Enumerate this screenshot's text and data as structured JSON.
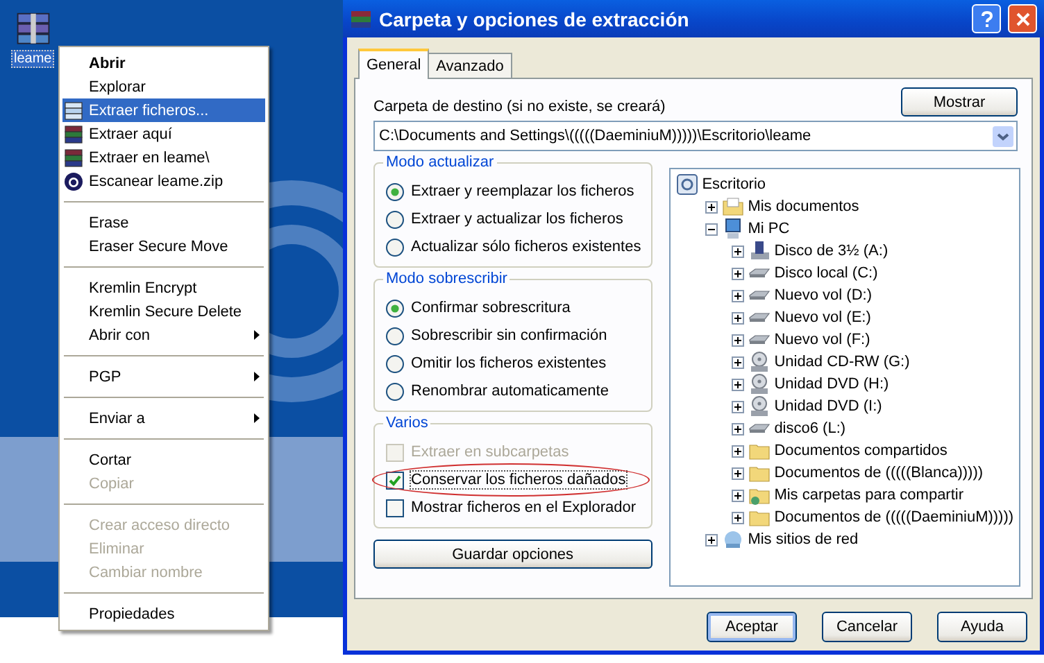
{
  "desktop": {
    "icon": {
      "label": "leame",
      "selected": true
    }
  },
  "context_menu": {
    "items": [
      {
        "kind": "text",
        "label": "Abrir",
        "bold": true,
        "selected": false,
        "disabled": false,
        "submenu": false
      },
      {
        "kind": "text",
        "label": "Explorar",
        "bold": false,
        "selected": false,
        "disabled": false,
        "submenu": false
      },
      {
        "kind": "archive-open",
        "label": "Extraer ficheros...",
        "bold": false,
        "selected": true,
        "disabled": false,
        "submenu": false
      },
      {
        "kind": "archive",
        "label": "Extraer aquí",
        "bold": false,
        "selected": false,
        "disabled": false,
        "submenu": false
      },
      {
        "kind": "archive",
        "label": "Extraer en leame\\",
        "bold": false,
        "selected": false,
        "disabled": false,
        "submenu": false
      },
      {
        "kind": "scan",
        "label": "Escanear leame.zip",
        "bold": false,
        "selected": false,
        "disabled": false,
        "submenu": false
      },
      {
        "kind": "separator"
      },
      {
        "kind": "text",
        "label": "Erase",
        "bold": false,
        "selected": false,
        "disabled": false,
        "submenu": false
      },
      {
        "kind": "text",
        "label": "Eraser Secure Move",
        "bold": false,
        "selected": false,
        "disabled": false,
        "submenu": false
      },
      {
        "kind": "separator"
      },
      {
        "kind": "text",
        "label": "Kremlin Encrypt",
        "bold": false,
        "selected": false,
        "disabled": false,
        "submenu": false
      },
      {
        "kind": "text",
        "label": "Kremlin Secure Delete",
        "bold": false,
        "selected": false,
        "disabled": false,
        "submenu": false
      },
      {
        "kind": "text",
        "label": "Abrir con",
        "bold": false,
        "selected": false,
        "disabled": false,
        "submenu": true
      },
      {
        "kind": "separator"
      },
      {
        "kind": "text",
        "label": "PGP",
        "bold": false,
        "selected": false,
        "disabled": false,
        "submenu": true
      },
      {
        "kind": "separator"
      },
      {
        "kind": "text",
        "label": "Enviar a",
        "bold": false,
        "selected": false,
        "disabled": false,
        "submenu": true
      },
      {
        "kind": "separator"
      },
      {
        "kind": "text",
        "label": "Cortar",
        "bold": false,
        "selected": false,
        "disabled": false,
        "submenu": false
      },
      {
        "kind": "text",
        "label": "Copiar",
        "bold": false,
        "selected": false,
        "disabled": true,
        "submenu": false
      },
      {
        "kind": "separator"
      },
      {
        "kind": "text",
        "label": "Crear acceso directo",
        "bold": false,
        "selected": false,
        "disabled": true,
        "submenu": false
      },
      {
        "kind": "text",
        "label": "Eliminar",
        "bold": false,
        "selected": false,
        "disabled": true,
        "submenu": false
      },
      {
        "kind": "text",
        "label": "Cambiar nombre",
        "bold": false,
        "selected": false,
        "disabled": true,
        "submenu": false
      },
      {
        "kind": "separator"
      },
      {
        "kind": "text",
        "label": "Propiedades",
        "bold": false,
        "selected": false,
        "disabled": false,
        "submenu": false
      }
    ]
  },
  "dialog": {
    "title": "Carpeta y opciones de extracción",
    "tabs": [
      {
        "label": "General",
        "selected": true
      },
      {
        "label": "Avanzado",
        "selected": false
      }
    ],
    "destination": {
      "label": "Carpeta de destino (si no existe, se creará)",
      "button": "Mostrar",
      "value": "C:\\Documents and Settings\\(((((DaeminiuM)))))\\Escritorio\\leame"
    },
    "groups": [
      {
        "title": "Modo actualizar",
        "kind": "radio",
        "options": [
          {
            "label": "Extraer y reemplazar los ficheros",
            "selected": true
          },
          {
            "label": "Extraer y actualizar los ficheros",
            "selected": false
          },
          {
            "label": "Actualizar sólo ficheros existentes",
            "selected": false
          }
        ]
      },
      {
        "title": "Modo sobrescribir",
        "kind": "radio",
        "options": [
          {
            "label": "Confirmar sobrescritura",
            "selected": true
          },
          {
            "label": "Sobrescribir sin confirmación",
            "selected": false
          },
          {
            "label": "Omitir los ficheros existentes",
            "selected": false
          },
          {
            "label": "Renombrar automaticamente",
            "selected": false
          }
        ]
      },
      {
        "title": "Varios",
        "kind": "checkbox",
        "options": [
          {
            "label": "Extraer en subcarpetas",
            "checked": false,
            "disabled": true,
            "circled": false
          },
          {
            "label": "Conservar los ficheros dañados",
            "checked": true,
            "disabled": false,
            "circled": true
          },
          {
            "label": "Mostrar ficheros en el Explorador",
            "checked": false,
            "disabled": false,
            "circled": false
          }
        ]
      }
    ],
    "save_button": "Guardar opciones",
    "tree": [
      {
        "label": "Escritorio",
        "kind": "desktop",
        "children": [
          {
            "label": "Mis documentos",
            "kind": "documents",
            "expanded": false
          },
          {
            "label": "Mi PC",
            "kind": "computer",
            "expanded": true,
            "children": [
              {
                "label": "Disco de 3½ (A:)",
                "kind": "floppy",
                "expanded": false
              },
              {
                "label": "Disco local (C:)",
                "kind": "drive",
                "expanded": false
              },
              {
                "label": "Nuevo vol (D:)",
                "kind": "drive",
                "expanded": false
              },
              {
                "label": "Nuevo vol (E:)",
                "kind": "drive",
                "expanded": false
              },
              {
                "label": "Nuevo vol (F:)",
                "kind": "drive",
                "expanded": false
              },
              {
                "label": "Unidad CD-RW (G:)",
                "kind": "cd",
                "expanded": false
              },
              {
                "label": "Unidad DVD (H:)",
                "kind": "cd",
                "expanded": false
              },
              {
                "label": "Unidad DVD (I:)",
                "kind": "cd",
                "expanded": false
              },
              {
                "label": "disco6 (L:)",
                "kind": "drive",
                "expanded": false
              },
              {
                "label": "Documentos compartidos",
                "kind": "folder",
                "expanded": false
              },
              {
                "label": "Documentos de (((((Blanca)))))",
                "kind": "folder",
                "expanded": false
              },
              {
                "label": "Mis carpetas para compartir",
                "kind": "shared",
                "expanded": false
              },
              {
                "label": "Documentos de (((((DaeminiuM)))))",
                "kind": "folder",
                "expanded": false
              }
            ]
          },
          {
            "label": "Mis sitios de red",
            "kind": "network",
            "expanded": false
          }
        ]
      }
    ],
    "buttons": [
      {
        "label": "Aceptar",
        "default": true
      },
      {
        "label": "Cancelar",
        "default": false
      },
      {
        "label": "Ayuda",
        "default": false
      }
    ]
  }
}
